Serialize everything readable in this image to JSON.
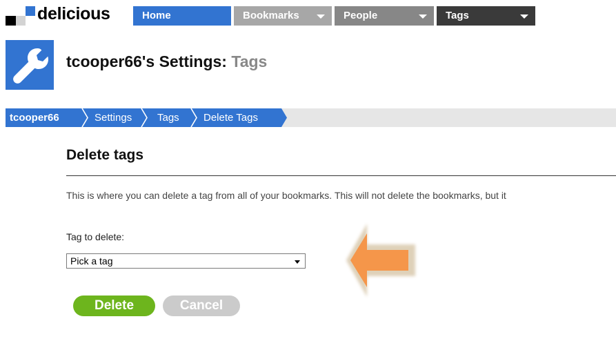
{
  "brand": {
    "name": "delicious"
  },
  "nav": {
    "home": "Home",
    "bookmarks": "Bookmarks",
    "people": "People",
    "tags": "Tags"
  },
  "header": {
    "title_main": "tcooper66's Settings:",
    "title_sub": "Tags"
  },
  "breadcrumb": {
    "user": "tcooper66",
    "settings": "Settings",
    "tags": "Tags",
    "current": "Delete Tags"
  },
  "section": {
    "title": "Delete tags",
    "description": "This is where you can delete a tag from all of your bookmarks. This will not delete the bookmarks, but it"
  },
  "form": {
    "label": "Tag to delete:",
    "selected": "Pick a tag",
    "delete_label": "Delete",
    "cancel_label": "Cancel"
  },
  "colors": {
    "brand_blue": "#3274d1",
    "delete_green": "#6db51d",
    "cancel_gray": "#cbcbcb",
    "annotation_orange": "#f5964a"
  }
}
